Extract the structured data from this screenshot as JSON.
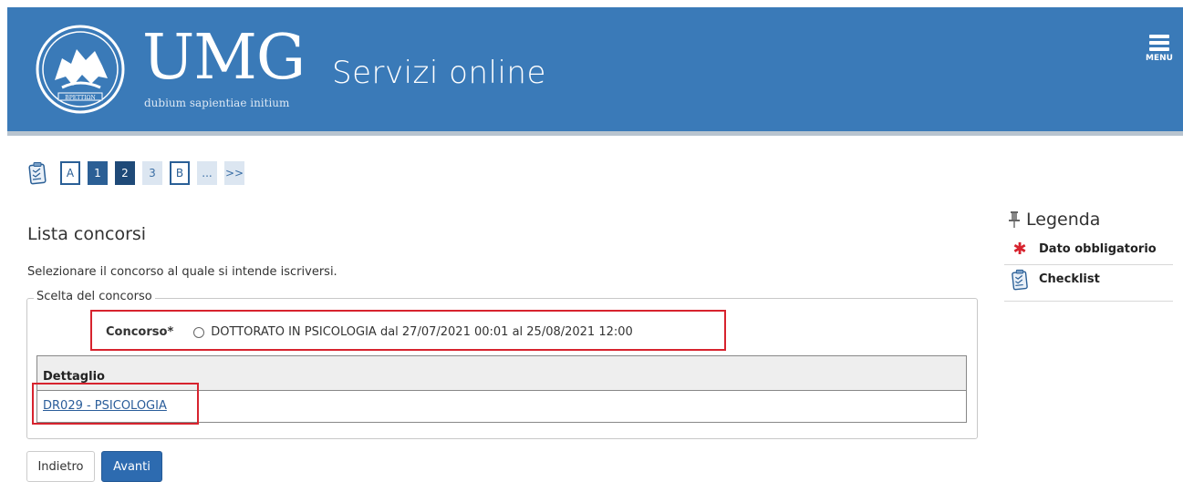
{
  "header": {
    "logo_text": "UMG",
    "logo_motto": "dubium sapientiae initium",
    "seal_text": "ΒΡΕΤΤΙΩΝ",
    "title": "Servizi online",
    "menu_label": "MENU",
    "bg_color": "#3a7ab8"
  },
  "steps": [
    {
      "label": "A",
      "style": "outlined"
    },
    {
      "label": "1",
      "style": "dark"
    },
    {
      "label": "2",
      "style": "darker",
      "current": true
    },
    {
      "label": "3",
      "style": "light"
    },
    {
      "label": "B",
      "style": "outlined"
    },
    {
      "label": "...",
      "style": "light"
    },
    {
      "label": ">>",
      "style": "light"
    }
  ],
  "main": {
    "title": "Lista concorsi",
    "subtitle": "Selezionare il concorso al quale si intende iscriversi.",
    "fieldset_legend": "Scelta del concorso",
    "concorso_label": "Concorso*",
    "concorso_option": "DOTTORATO IN PSICOLOGIA dal 27/07/2021 00:01 al 25/08/2021 12:00",
    "detail_header": "Dettaglio",
    "detail_link": "DR029 - PSICOLOGIA"
  },
  "buttons": {
    "back": "Indietro",
    "next": "Avanti"
  },
  "legend": {
    "title": "Legenda",
    "items": [
      {
        "icon": "asterisk-icon",
        "label": "Dato obbligatorio"
      },
      {
        "icon": "checklist-icon",
        "label": "Checklist"
      }
    ]
  },
  "colors": {
    "accent": "#2d6bb0",
    "highlight": "#d7232e",
    "link": "#2a5d9a"
  }
}
